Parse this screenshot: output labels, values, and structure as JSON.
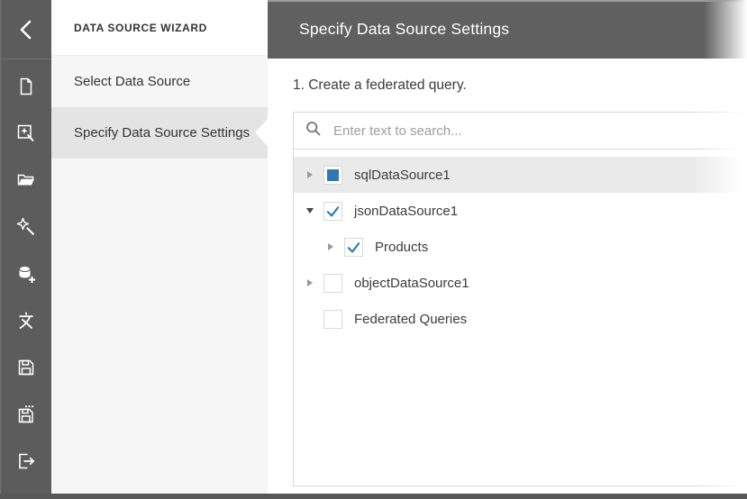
{
  "sidebar": {
    "back": {
      "icon": "chevron-left-icon"
    },
    "icons": [
      {
        "name": "new-report-icon"
      },
      {
        "name": "report-wizard-icon"
      },
      {
        "name": "open-report-icon"
      },
      {
        "name": "magic-wand-icon"
      },
      {
        "name": "add-data-source-icon"
      },
      {
        "name": "localization-icon"
      },
      {
        "name": "save-icon"
      },
      {
        "name": "save-as-icon"
      },
      {
        "name": "exit-icon"
      }
    ]
  },
  "wizard_nav": {
    "title": "DATA SOURCE WIZARD",
    "items": [
      {
        "label": "Select Data Source",
        "selected": false
      },
      {
        "label": "Specify Data Source Settings",
        "selected": true
      }
    ]
  },
  "main": {
    "header_title": "Specify Data Source Settings",
    "step_text": "1. Create a federated query.",
    "search": {
      "placeholder": "Enter text to search...",
      "icon": "search-icon"
    },
    "tree": {
      "rows": [
        {
          "label": "sqlDataSource1",
          "checkbox": "indeterminate",
          "expander": "collapsed",
          "level": 0,
          "highlighted": true
        },
        {
          "label": "jsonDataSource1",
          "checkbox": "checked",
          "expander": "expanded",
          "level": 0,
          "highlighted": false
        },
        {
          "label": "Products",
          "checkbox": "checked",
          "expander": "collapsed",
          "level": 1,
          "highlighted": false
        },
        {
          "label": "objectDataSource1",
          "checkbox": "unchecked",
          "expander": "collapsed",
          "level": 0,
          "highlighted": false
        },
        {
          "label": "Federated Queries",
          "checkbox": "unchecked",
          "expander": "none",
          "level": 0,
          "highlighted": false
        }
      ]
    }
  },
  "colors": {
    "sidebar_bg": "#5c5c5c",
    "header_bg": "#606060",
    "bottom_bar_bg": "#585858",
    "nav_bg": "#f6f6f6",
    "nav_selected_bg": "#e4e4e4",
    "highlight_row_bg": "#eaeaea",
    "accent_blue": "#2e79b5"
  }
}
